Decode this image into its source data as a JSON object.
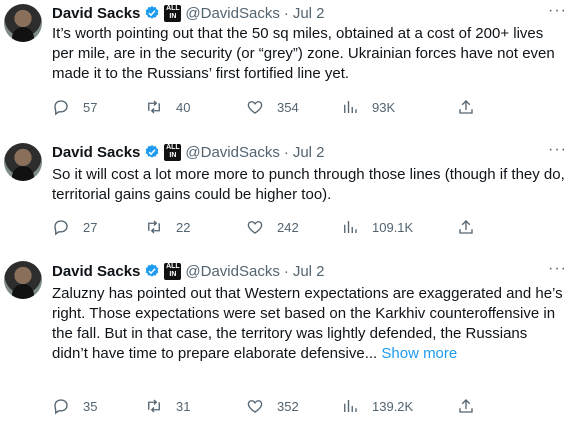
{
  "icons": {
    "verified": "verified-badge-icon",
    "affiliate": "all-in-affiliate-icon",
    "reply": "reply-icon",
    "retweet": "retweet-icon",
    "like": "like-icon",
    "views": "views-icon",
    "share": "share-icon",
    "more": "more-options-icon"
  },
  "colors": {
    "text": "#0f1419",
    "muted": "#536471",
    "link": "#1d9bf0",
    "verified": "#1d9bf0"
  },
  "tweets": [
    {
      "author": "David Sacks",
      "affiliate": "ALL IN",
      "handle": "@DavidSacks",
      "separator": "·",
      "date": "Jul 2",
      "more": "···",
      "text": "It’s worth pointing out that the 50 sq miles, obtained at a cost of 200+ lives per mile, are in the security (or “grey”) zone. Ukrainian forces have not even made it to the Russians’ first fortified line yet.",
      "show_more": "",
      "replies": "57",
      "retweets": "40",
      "likes": "354",
      "views": "93K"
    },
    {
      "author": "David Sacks",
      "affiliate": "ALL IN",
      "handle": "@DavidSacks",
      "separator": "·",
      "date": "Jul 2",
      "more": "···",
      "text": "So it will cost a lot more more to punch through those lines (though if they do, territorial gains gains could be higher too).",
      "show_more": "",
      "replies": "27",
      "retweets": "22",
      "likes": "242",
      "views": "109.1K"
    },
    {
      "author": "David Sacks",
      "affiliate": "ALL IN",
      "handle": "@DavidSacks",
      "separator": "·",
      "date": "Jul 2",
      "more": "···",
      "text": "Zaluzny has pointed out that Western expectations are exaggerated and he’s right. Those expectations were set based on the Karkhiv counteroffensive in the fall. But in that case, the territory was lightly defended, the Russians didn’t have time to prepare elaborate defensive...",
      "show_more": "Show more",
      "replies": "35",
      "retweets": "31",
      "likes": "352",
      "views": "139.2K"
    }
  ]
}
